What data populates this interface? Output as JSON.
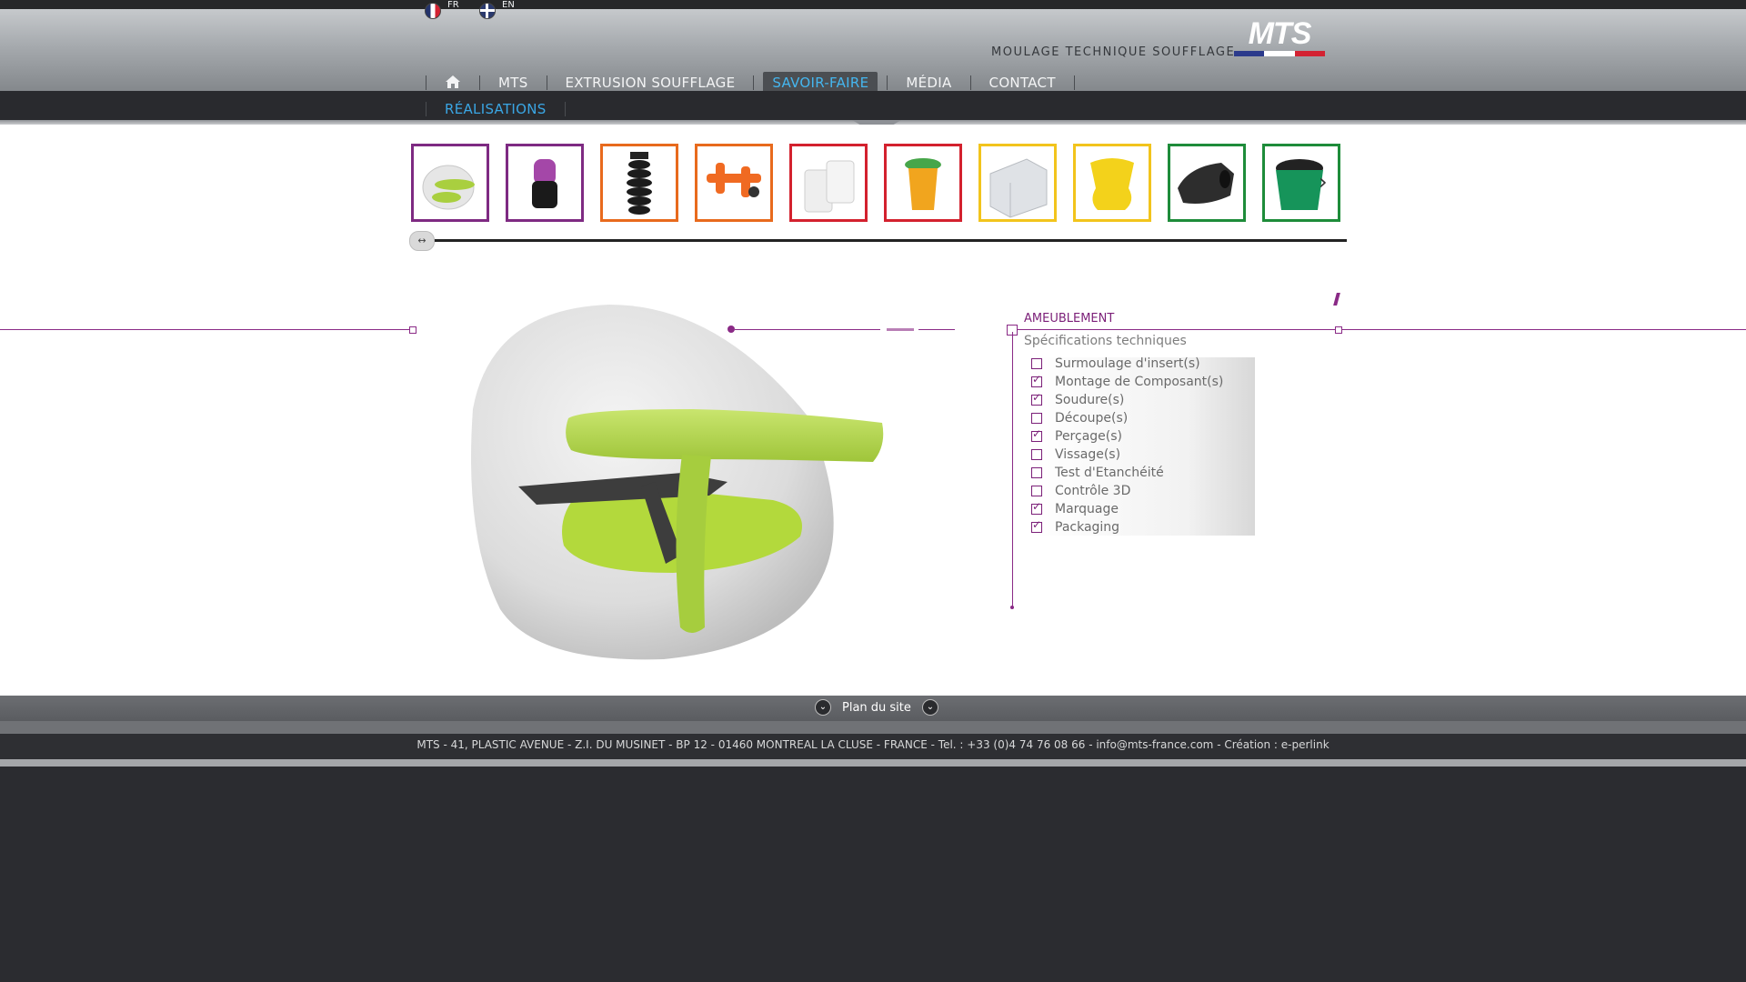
{
  "languages": [
    {
      "code": "FR",
      "label": "FR"
    },
    {
      "code": "EN",
      "label": "EN"
    }
  ],
  "brand": {
    "tagline": "MOULAGE TECHNIQUE SOUFFLAGE",
    "logo_text": "MTS",
    "flag_colors": [
      "#2b3a8c",
      "#ffffff",
      "#d32232"
    ]
  },
  "nav": {
    "home_icon": "home-icon",
    "items": [
      {
        "label": "MTS",
        "active": false
      },
      {
        "label": "EXTRUSION SOUFFLAGE",
        "active": false
      },
      {
        "label": "SAVOIR-FAIRE",
        "active": true
      },
      {
        "label": "MÉDIA",
        "active": false
      },
      {
        "label": "CONTACT",
        "active": false
      }
    ],
    "active_color": "#45b6ef"
  },
  "subnav": {
    "items": [
      {
        "label": "RÉALISATIONS",
        "active": true
      }
    ]
  },
  "gallery": {
    "thumbnails": [
      {
        "product": "white-green baby seat",
        "border": "#7e2a82"
      },
      {
        "product": "purple-black bottle",
        "border": "#7e2a82"
      },
      {
        "product": "black corrugated duct",
        "border": "#e86a1d"
      },
      {
        "product": "orange handles part",
        "border": "#e86a1d"
      },
      {
        "product": "white jerrican",
        "border": "#d3212e"
      },
      {
        "product": "yellow-green bin",
        "border": "#d3212e"
      },
      {
        "product": "grey filter panel",
        "border": "#f2c41c"
      },
      {
        "product": "yellow seat",
        "border": "#f2c41c"
      },
      {
        "product": "black air duct",
        "border": "#1e8c3a"
      },
      {
        "product": "green bucket",
        "border": "#1e8c3a"
      }
    ],
    "next_icon": "chevron-right-icon",
    "scroll_handle_icon": "left-right-arrows-icon"
  },
  "detail": {
    "category": "AMEUBLEMENT",
    "specs_title": "Spécifications techniques",
    "accent_color": "#8a2a86",
    "specs": [
      {
        "label": "Surmoulage d'insert(s)",
        "checked": false
      },
      {
        "label": "Montage de Composant(s)",
        "checked": true
      },
      {
        "label": "Soudure(s)",
        "checked": true
      },
      {
        "label": "Découpe(s)",
        "checked": false
      },
      {
        "label": "Perçage(s)",
        "checked": true
      },
      {
        "label": "Vissage(s)",
        "checked": false
      },
      {
        "label": "Test d'Etanchéité",
        "checked": false
      },
      {
        "label": "Contrôle 3D",
        "checked": false
      },
      {
        "label": "Marquage",
        "checked": true
      },
      {
        "label": "Packaging",
        "checked": true
      }
    ]
  },
  "footer": {
    "plan_label": "Plan du site",
    "address": "MTS - 41, PLASTIC AVENUE - Z.I. DU MUSINET - BP 12 - 01460 MONTREAL LA CLUSE - FRANCE - Tel. : +33 (0)4 74 76 08 66 - info@mts-france.com - Création : e-perlink"
  }
}
